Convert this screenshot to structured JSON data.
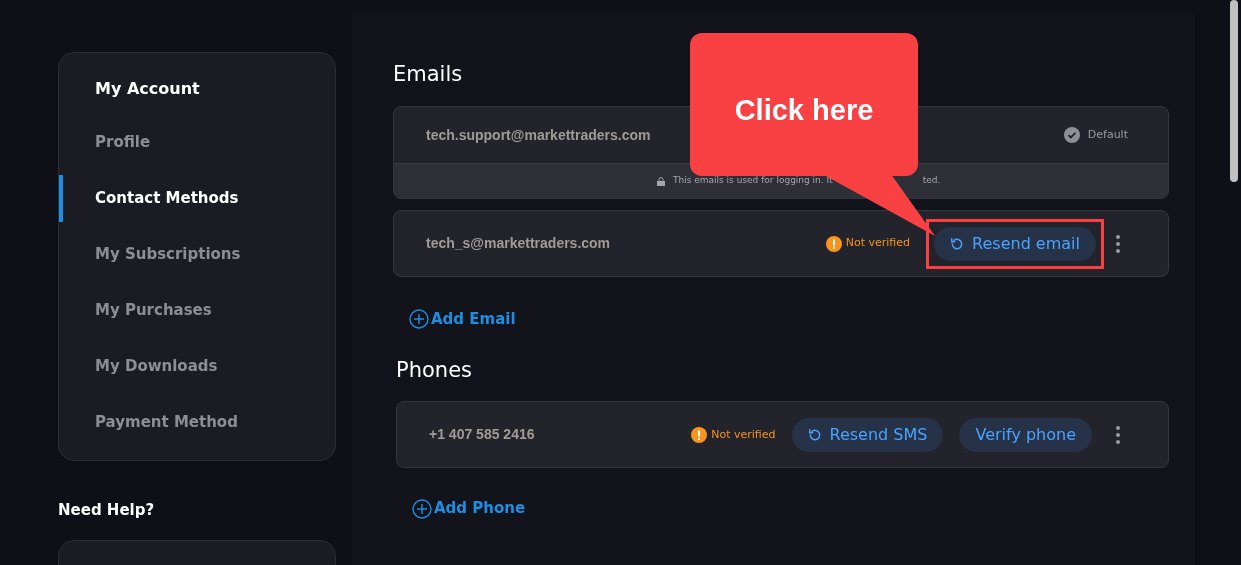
{
  "sidebar": {
    "title": "My Account",
    "items": [
      {
        "label": "Profile",
        "selected": false
      },
      {
        "label": "Contact Methods",
        "selected": true
      },
      {
        "label": "My Subscriptions",
        "selected": false
      },
      {
        "label": "My Purchases",
        "selected": false
      },
      {
        "label": "My Downloads",
        "selected": false
      },
      {
        "label": "Payment Method",
        "selected": false
      }
    ]
  },
  "help": {
    "title": "Need Help?"
  },
  "emails": {
    "title": "Emails",
    "items": [
      {
        "address": "tech.support@markettraders.com",
        "kind": "default",
        "badge": "Default",
        "note_start": "This emails is used for logging in. It",
        "note_end": "ted."
      },
      {
        "address": "tech_s@markettraders.com",
        "kind": "unverified",
        "status": "Not verified",
        "buttons": [
          {
            "label": "Resend email",
            "kind": "resend",
            "highlighted": true
          }
        ]
      }
    ],
    "add": "Add Email"
  },
  "phones": {
    "title": "Phones",
    "items": [
      {
        "address": "+1 407 585 2416",
        "kind": "unverified",
        "status": "Not verified",
        "buttons": [
          {
            "label": "Resend SMS",
            "kind": "resend",
            "highlighted": false
          },
          {
            "label": "Verify phone",
            "kind": "verify",
            "highlighted": false
          }
        ]
      }
    ],
    "add": "Add Phone"
  },
  "callout": {
    "text": "Click here"
  }
}
